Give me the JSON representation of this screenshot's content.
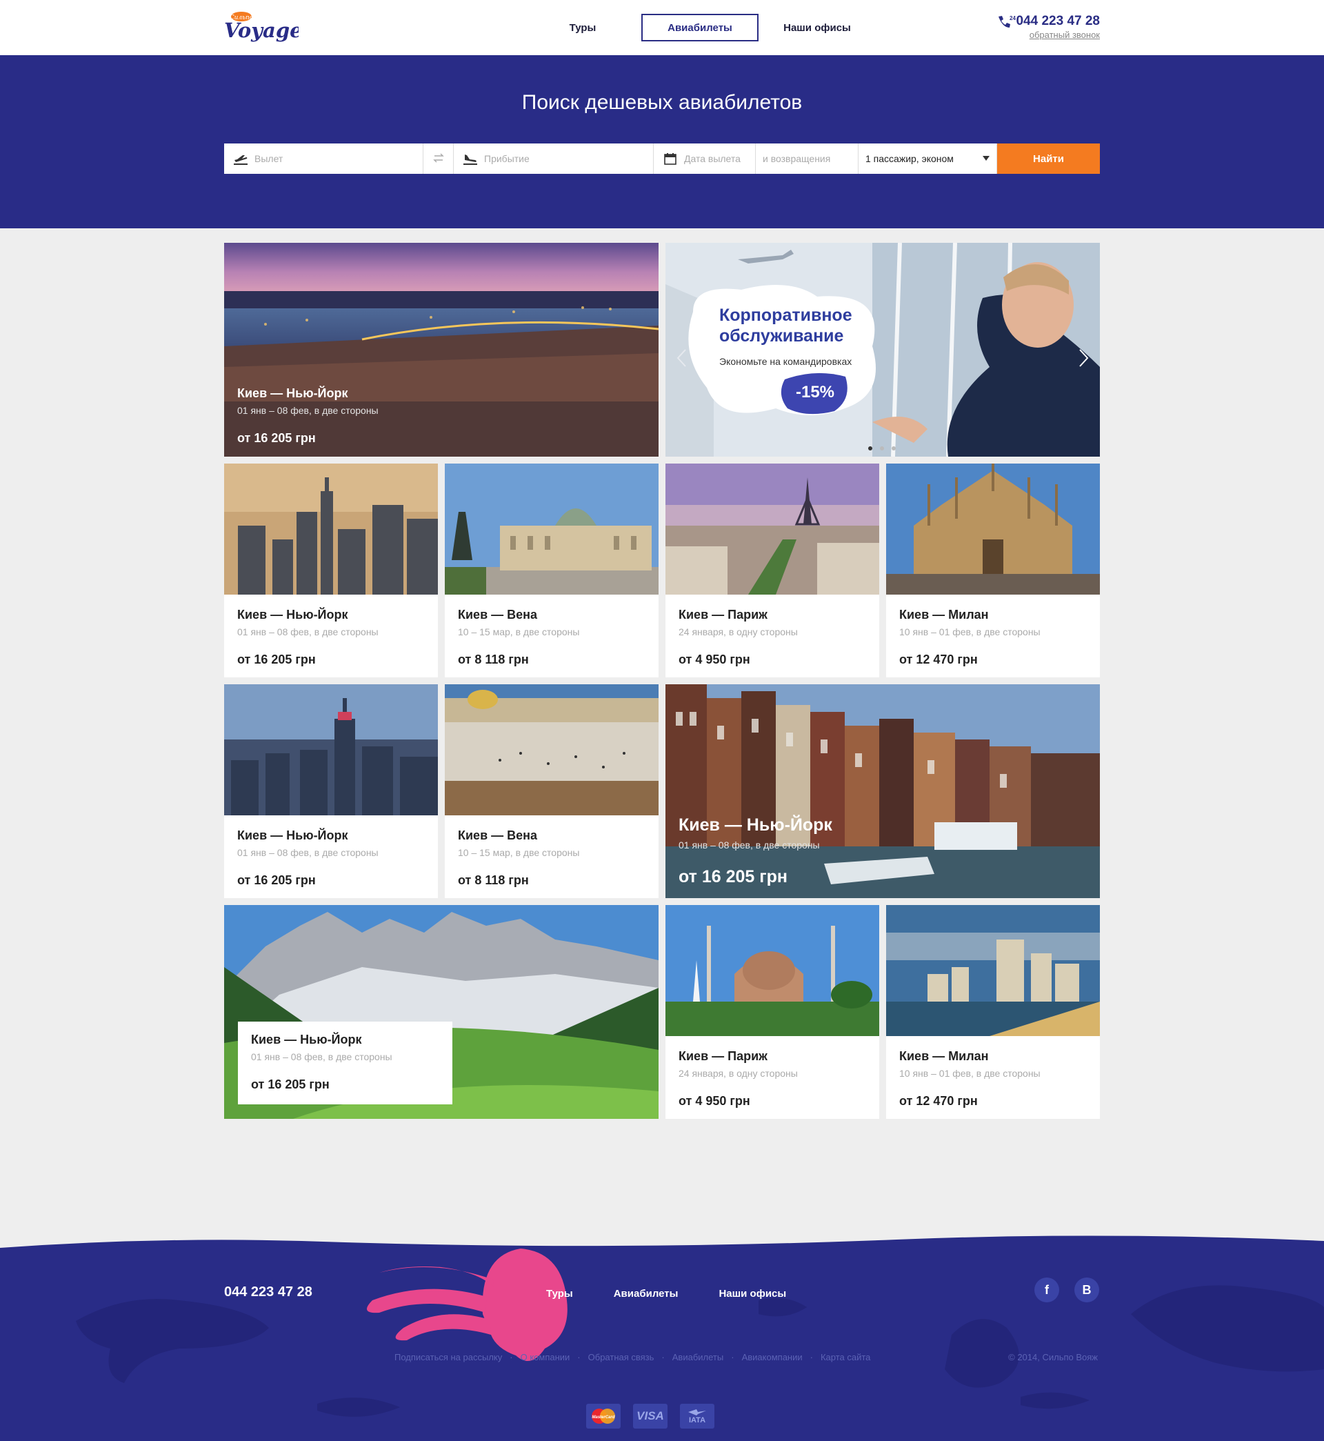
{
  "header": {
    "logo_top": "Сильпо",
    "logo_main": "Voyage",
    "nav": [
      {
        "label": "Туры",
        "active": false
      },
      {
        "label": "Авиабилеты",
        "active": true
      },
      {
        "label": "Наши офисы",
        "active": false
      }
    ],
    "phone_badge": "24",
    "phone": "044 223 47 28",
    "callback": "обратный звонок"
  },
  "hero": {
    "title": "Поиск дешевых авиабилетов",
    "search": {
      "depart_placeholder": "Вылет",
      "arrive_placeholder": "Прибытие",
      "date_depart_placeholder": "Дата вылета",
      "date_return_placeholder": "и возвращения",
      "passengers": "1 пассажир, эконом",
      "submit": "Найти"
    }
  },
  "promo": {
    "title_line1": "Корпоративное",
    "title_line2": "обслуживание",
    "subtitle": "Экономьте на командировках",
    "discount": "-15%",
    "slides": 3,
    "active_slide": 1
  },
  "tiles": [
    {
      "route": "Киев — Нью-Йорк",
      "dates": "01 янв – 08 фев, в две стороны",
      "price": "от 16 205 грн"
    },
    {
      "route": "Киев — Нью-Йорк",
      "dates": "01 янв – 08 фев, в две стороны",
      "price": "от 16 205 грн"
    },
    {
      "route": "Киев — Вена",
      "dates": "10 – 15 мар, в две стороны",
      "price": "от 8 118 грн"
    },
    {
      "route": "Киев — Париж",
      "dates": "24 января, в одну стороны",
      "price": "от 4 950 грн"
    },
    {
      "route": "Киев — Милан",
      "dates": "10 янв – 01 фев, в две стороны",
      "price": "от 12 470 грн"
    },
    {
      "route": "Киев — Нью-Йорк",
      "dates": "01 янв – 08 фев, в две стороны",
      "price": "от 16 205 грн"
    },
    {
      "route": "Киев — Вена",
      "dates": "10 – 15 мар, в две стороны",
      "price": "от 8 118 грн"
    },
    {
      "route": "Киев — Нью-Йорк",
      "dates": "01 янв – 08 фев, в две стороны",
      "price": "от 16 205 грн"
    },
    {
      "route": "Киев — Нью-Йорк",
      "dates": "01 янв – 08 фев, в две стороны",
      "price": "от 16 205 грн"
    },
    {
      "route": "Киев — Париж",
      "dates": "24 января, в одну стороны",
      "price": "от 4 950 грн"
    },
    {
      "route": "Киев — Милан",
      "dates": "10 янв – 01 фев, в две стороны",
      "price": "от 12 470 грн"
    }
  ],
  "footer": {
    "phone": "044 223 47 28",
    "nav": [
      "Туры",
      "Авиабилеты",
      "Наши офисы"
    ],
    "social": [
      "f",
      "B"
    ],
    "links": [
      "Подписаться на рассылку",
      "О компании",
      "Обратная связь",
      "Авиабилеты",
      "Авиакомпании",
      "Карта сайта"
    ],
    "separator": "·",
    "copyright": "© 2014, Сильпо Вояж",
    "payments": [
      "MasterCard",
      "VISA",
      "IATA"
    ]
  },
  "colors": {
    "brand_blue": "#292c87",
    "accent_orange": "#f47b20",
    "jellyfish_pink": "#e8478c"
  }
}
